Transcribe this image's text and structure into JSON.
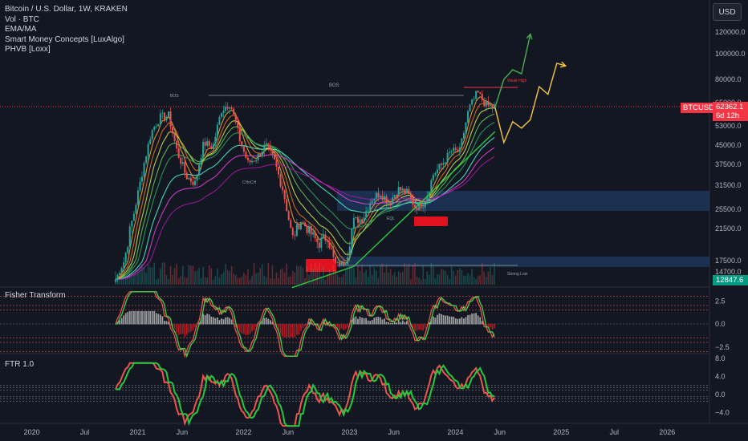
{
  "legend": {
    "title": "Bitcoin / U.S. Dollar, 1W, KRAKEN",
    "items": [
      "Vol · BTC",
      "EMA/MA",
      "Smart Money Concepts [LuxAlgo]",
      "PHVB [Loxx]"
    ]
  },
  "currency_button": "USD",
  "price_tags": {
    "symbol": "BTCUSD",
    "price": "62362.1",
    "countdown": "6d 12h",
    "low_price": "12847.6"
  },
  "annotations": {
    "bos": "BOS",
    "weak_high": "Weak High",
    "strong_low": "Strong Low",
    "choch": "CHoCH",
    "eql": "EQL"
  },
  "colors": {
    "bull": "#26a69a",
    "bear": "#ef5350",
    "forecast_up": "#4caf50",
    "forecast_alt": "#f5c542",
    "trendline": "#2ecc40",
    "price_line": "#f23645"
  },
  "panes": [
    {
      "id": "price",
      "axis_labels": [
        "120000.0",
        "100000.0",
        "80000.0",
        "65000.0",
        "53000.0",
        "45000.0",
        "37500.0",
        "31500.0",
        "25500.0",
        "21500.0",
        "17500.0",
        "14700.0"
      ],
      "axis_values": [
        120000,
        100000,
        80000,
        65000,
        53000,
        45000,
        37500,
        31500,
        25500,
        21500,
        17500,
        14700
      ]
    },
    {
      "id": "fisher",
      "title": "Fisher Transform",
      "axis_labels": [
        "2.5",
        "0.0",
        "−2.5"
      ],
      "axis_values": [
        2.5,
        0.0,
        -2.5
      ],
      "levels": [
        3.0,
        2.0,
        1.5,
        -1.5,
        -2.0,
        -3.0
      ]
    },
    {
      "id": "ftr",
      "title": "FTR 1.0",
      "axis_labels": [
        "8.0",
        "4.0",
        "0.0",
        "−4.0"
      ],
      "axis_values": [
        8.0,
        4.0,
        0.0,
        -4.0
      ]
    }
  ],
  "time_axis": [
    "2020",
    "Jul",
    "2021",
    "Jun",
    "2022",
    "Jun",
    "2023",
    "Jun",
    "2024",
    "Jun",
    "2025",
    "Jul",
    "2026"
  ],
  "chart_data": {
    "type": "line",
    "title": "Bitcoin / U.S. Dollar, 1W, KRAKEN",
    "xlabel": "",
    "ylabel": "",
    "log_scale": true,
    "grid": false,
    "ylim": [
      12847.6,
      125000
    ],
    "series": [
      {
        "name": "BTCUSD",
        "points": [
          [
            "2020-10",
            13000
          ],
          [
            "2020-11",
            17500
          ],
          [
            "2020-12",
            24000
          ],
          [
            "2021-01",
            35000
          ],
          [
            "2021-02",
            50000
          ],
          [
            "2021-03",
            57000
          ],
          [
            "2021-04",
            58000
          ],
          [
            "2021-05",
            42000
          ],
          [
            "2021-06",
            34000
          ],
          [
            "2021-07",
            32000
          ],
          [
            "2021-08",
            46000
          ],
          [
            "2021-09",
            44000
          ],
          [
            "2021-10",
            61000
          ],
          [
            "2021-11",
            65000
          ],
          [
            "2021-12",
            48000
          ],
          [
            "2022-01",
            38000
          ],
          [
            "2022-02",
            40000
          ],
          [
            "2022-03",
            45000
          ],
          [
            "2022-04",
            38500
          ],
          [
            "2022-05",
            30000
          ],
          [
            "2022-06",
            20000
          ],
          [
            "2022-07",
            23000
          ],
          [
            "2022-08",
            21000
          ],
          [
            "2022-09",
            19500
          ],
          [
            "2022-10",
            20500
          ],
          [
            "2022-11",
            16500
          ],
          [
            "2022-12",
            16800
          ],
          [
            "2023-01",
            23000
          ],
          [
            "2023-02",
            23500
          ],
          [
            "2023-03",
            28000
          ],
          [
            "2023-04",
            29500
          ],
          [
            "2023-05",
            27000
          ],
          [
            "2023-06",
            30500
          ],
          [
            "2023-07",
            29500
          ],
          [
            "2023-08",
            26000
          ],
          [
            "2023-09",
            27000
          ],
          [
            "2023-10",
            34500
          ],
          [
            "2023-11",
            37500
          ],
          [
            "2023-12",
            42500
          ],
          [
            "2024-01",
            42500
          ],
          [
            "2024-02",
            61000
          ],
          [
            "2024-03",
            71000
          ],
          [
            "2024-04",
            63500
          ],
          [
            "2024-05",
            62362.1
          ]
        ]
      },
      {
        "name": "",
        "points": [
          [
            "2024-05",
            62362.1
          ],
          [
            "2024-06",
            80000
          ],
          [
            "2024-07",
            87000
          ],
          [
            "2024-08",
            84000
          ],
          [
            "2024-09",
            118000
          ]
        ]
      },
      {
        "name": "",
        "points": [
          [
            "2024-05",
            62362.1
          ],
          [
            "2024-06",
            46000
          ],
          [
            "2024-07",
            55000
          ],
          [
            "2024-08",
            52000
          ],
          [
            "2024-09",
            56000
          ],
          [
            "2024-10",
            75000
          ],
          [
            "2024-11",
            70000
          ],
          [
            "2024-12",
            92000
          ],
          [
            "2025-01",
            90000
          ]
        ]
      },
      {
        "name": "",
        "points": [
          [
            "2022-06",
            11500
          ],
          [
            "2023-01",
            16000
          ],
          [
            "2024-05",
            50500
          ]
        ]
      }
    ]
  }
}
